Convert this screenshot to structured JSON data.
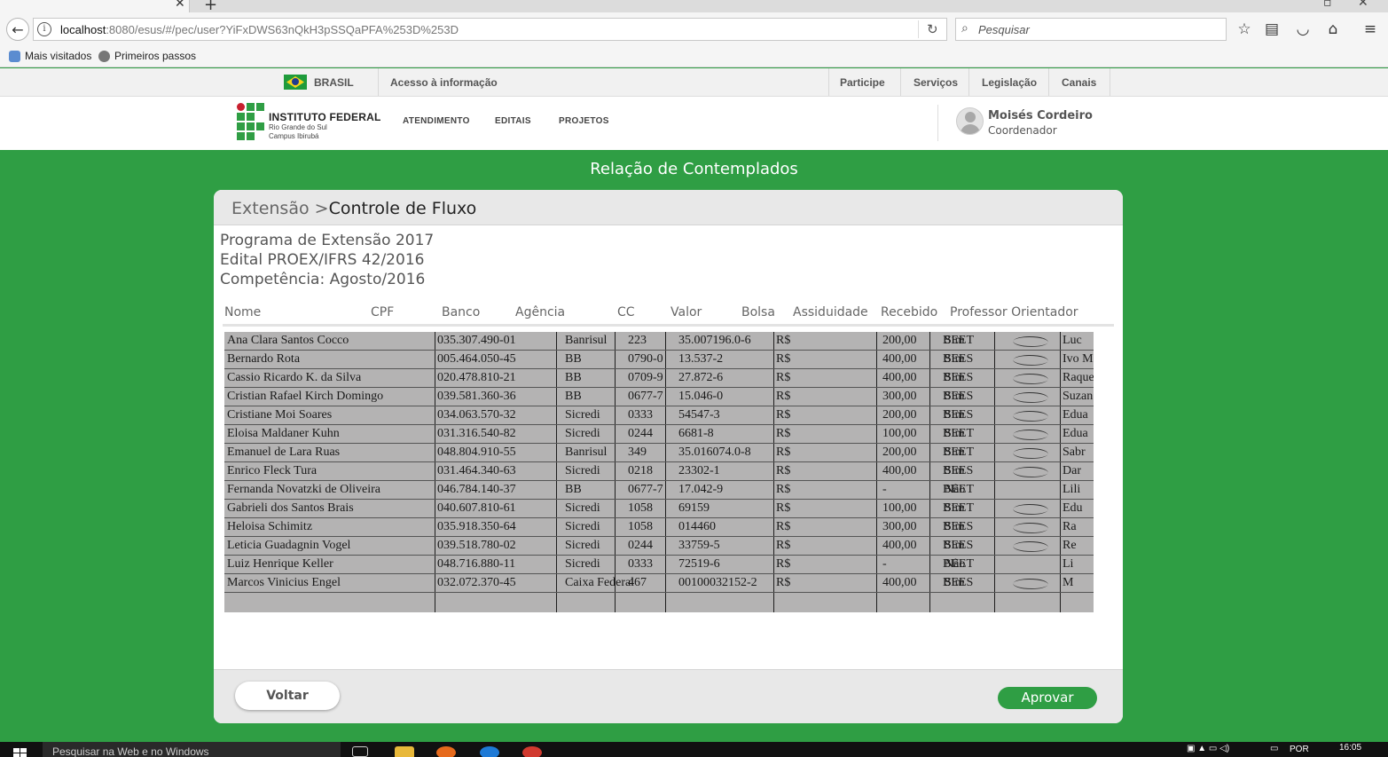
{
  "browser": {
    "url_host": "localhost",
    "url_path": ":8080/esus/#/pec/user?YiFxDWS63nQkH3pSSQaPFA%253D%253D",
    "search_placeholder": "Pesquisar",
    "bookmarks": [
      "Mais visitados",
      "Primeiros passos"
    ]
  },
  "govbar": {
    "country": "BRASIL",
    "access": "Acesso à informação",
    "links": [
      "Participe",
      "Serviços",
      "Legislação",
      "Canais"
    ]
  },
  "site": {
    "logo_name": "INSTITUTO FEDERAL",
    "logo_sub1": "Rio Grande do Sul",
    "logo_sub2": "Campus Ibirubá",
    "nav": [
      "ATENDIMENTO",
      "EDITAIS",
      "PROJETOS"
    ],
    "user_name": "Moisés Cordeiro",
    "user_role": "Coordenador"
  },
  "page": {
    "title": "Relação de Contemplados",
    "breadcrumb_parent": "Extensão >",
    "breadcrumb_current": "Controle de Fluxo",
    "program": "Programa de Extensão 2017",
    "edital": "Edital PROEX/IFRS 42/2016",
    "competencia": "Competência: Agosto/2016",
    "columns": [
      "Nome",
      "CPF",
      "Banco",
      "Agência",
      "CC",
      "Valor",
      "Bolsa",
      "Assiduidade",
      "Recebido",
      "Professor Orientador"
    ],
    "back_label": "Voltar",
    "approve_label": "Aprovar"
  },
  "scan_rows": [
    [
      "Ana Clara Santos Cocco",
      "035.307.490-01",
      "Banrisul",
      "223",
      "35.007196.0-6",
      "R$",
      "200,00",
      "BEET",
      "Sim",
      "Luc"
    ],
    [
      "Bernardo Rota",
      "005.464.050-45",
      "BB",
      "0790-0",
      "13.537-2",
      "R$",
      "400,00",
      "BEES",
      "Sim",
      "Ivo M"
    ],
    [
      "Cassio Ricardo K. da Silva",
      "020.478.810-21",
      "BB",
      "0709-9",
      "27.872-6",
      "R$",
      "400,00",
      "BEES",
      "Sim",
      "Raque"
    ],
    [
      "Cristian Rafael Kirch Domingo",
      "039.581.360-36",
      "BB",
      "0677-7",
      "15.046-0",
      "R$",
      "300,00",
      "BEES",
      "Sim",
      "Suzan"
    ],
    [
      "Cristiane Moi Soares",
      "034.063.570-32",
      "Sicredi",
      "0333",
      "54547-3",
      "R$",
      "200,00",
      "BEES",
      "Sim",
      "Edua"
    ],
    [
      "Eloisa Maldaner Kuhn",
      "031.316.540-82",
      "Sicredi",
      "0244",
      "6681-8",
      "R$",
      "100,00",
      "BEET",
      "Sim",
      "Edua"
    ],
    [
      "Emanuel de Lara Ruas",
      "048.804.910-55",
      "Banrisul",
      "349",
      "35.016074.0-8",
      "R$",
      "200,00",
      "BEET",
      "Sim",
      "Sabr"
    ],
    [
      "Enrico Fleck Tura",
      "031.464.340-63",
      "Sicredi",
      "0218",
      "23302-1",
      "R$",
      "400,00",
      "BEES",
      "Sim",
      "Dar"
    ],
    [
      "Fernanda Novatzki de Oliveira",
      "046.784.140-37",
      "BB",
      "0677-7",
      "17.042-9",
      "R$",
      "-",
      "BEET",
      "Não",
      "Lili"
    ],
    [
      "Gabrieli dos Santos Brais",
      "040.607.810-61",
      "Sicredi",
      "1058",
      "69159",
      "R$",
      "100,00",
      "BEET",
      "Sim",
      "Edu"
    ],
    [
      "Heloisa Schimitz",
      "035.918.350-64",
      "Sicredi",
      "1058",
      "014460",
      "R$",
      "300,00",
      "BEES",
      "Sim",
      "Ra"
    ],
    [
      "Leticia Guadagnin Vogel",
      "039.518.780-02",
      "Sicredi",
      "0244",
      "33759-5",
      "R$",
      "400,00",
      "BEES",
      "Sim",
      "Re"
    ],
    [
      "Luiz Henrique Keller",
      "048.716.880-11",
      "Sicredi",
      "0333",
      "72519-6",
      "R$",
      "-",
      "BEET",
      "Não",
      "Li"
    ],
    [
      "Marcos Vinicius Engel",
      "032.072.370-45",
      "Caixa Federal",
      "467",
      "00100032152-2",
      "R$",
      "400,00",
      "BEES",
      "Sim",
      "M"
    ]
  ],
  "taskbar": {
    "search_text": "Pesquisar na Web e no Windows",
    "lang": "POR",
    "time": "16:05"
  }
}
